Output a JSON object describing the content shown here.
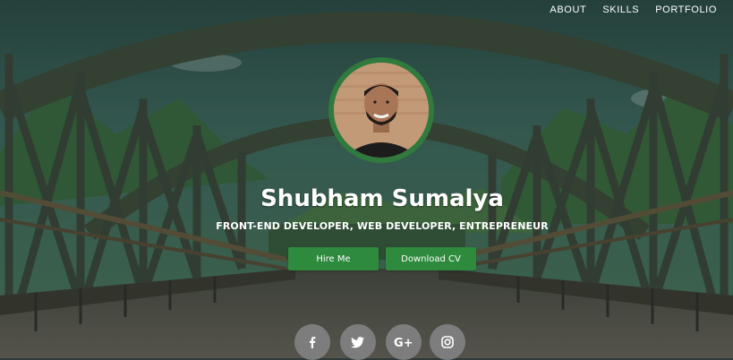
{
  "nav": {
    "items": [
      {
        "label": "ABOUT"
      },
      {
        "label": "SKILLS"
      },
      {
        "label": "PORTFOLIO"
      }
    ]
  },
  "profile": {
    "name": "Shubham Sumalya",
    "tagline": "FRONT-END DEVELOPER, WEB DEVELOPER, ENTREPRENEUR"
  },
  "actions": {
    "hire_label": "Hire Me",
    "download_label": "Download CV"
  },
  "social": [
    {
      "icon": "facebook-icon"
    },
    {
      "icon": "twitter-icon"
    },
    {
      "icon": "google-plus-icon"
    },
    {
      "icon": "instagram-icon"
    }
  ],
  "colors": {
    "accent": "#2e8a3c",
    "avatar_ring": "#2f7a3c",
    "social_bg": "#7d7d7d"
  }
}
